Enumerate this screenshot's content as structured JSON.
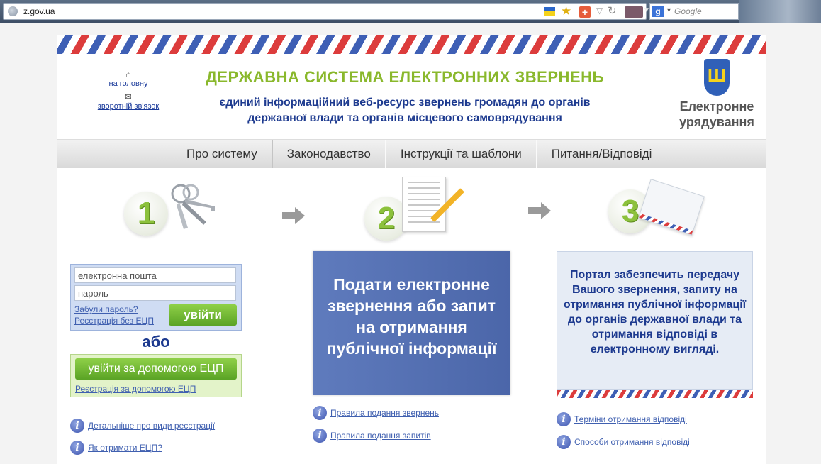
{
  "browser": {
    "url": "z.gov.ua",
    "search_placeholder": "Google"
  },
  "header": {
    "home_link": "на головну",
    "feedback_link": "зворотній зв'язок",
    "title": "ДЕРЖАВНА СИСТЕМА ЕЛЕКТРОННИХ ЗВЕРНЕНЬ",
    "subtitle_line1": "єдиний інформаційний веб-ресурс звернень громадян до органів",
    "subtitle_line2": "державної влади та органів місцевого самоврядування",
    "gov_line1": "Електронне",
    "gov_line2": "урядування"
  },
  "nav": {
    "items": [
      {
        "label": "Про систему"
      },
      {
        "label": "Законодавство"
      },
      {
        "label": "Інструкції та шаблони"
      },
      {
        "label": "Питання/Відповіді"
      }
    ]
  },
  "steps": {
    "step1": "1",
    "step2": "2",
    "step3": "3"
  },
  "login": {
    "email_placeholder": "електронна пошта",
    "password_placeholder": "пароль",
    "forgot": "Забули пароль?",
    "register_no_key": "Реєстрація без ЕЦП",
    "login_button": "увійти",
    "or": "або",
    "eds_button": "увійти за допомогою ЕЦП",
    "eds_register": "Реєстрація за допомогою ЕЦП"
  },
  "center": {
    "box_text": "Подати електронне звернення або запит на отримання публічної інформації"
  },
  "right": {
    "box_text": "Портал забезпечить передачу Вашого звернення, запиту на отримання публічної інформації до органів державної влади та отримання відповіді в електронному вигляді."
  },
  "links": {
    "left1": "Детальніше про види реєстрації",
    "left2": "Як отримати ЕЦП?",
    "center1": "Правила подання звернень",
    "center2": "Правила подання запитів",
    "right1": "Терміни отримання відповіді",
    "right2": "Способи отримання відповіді"
  },
  "colors": {
    "title_green": "#8ab82c",
    "brand_blue": "#1d3a8f",
    "button_green": "#5aa325"
  }
}
